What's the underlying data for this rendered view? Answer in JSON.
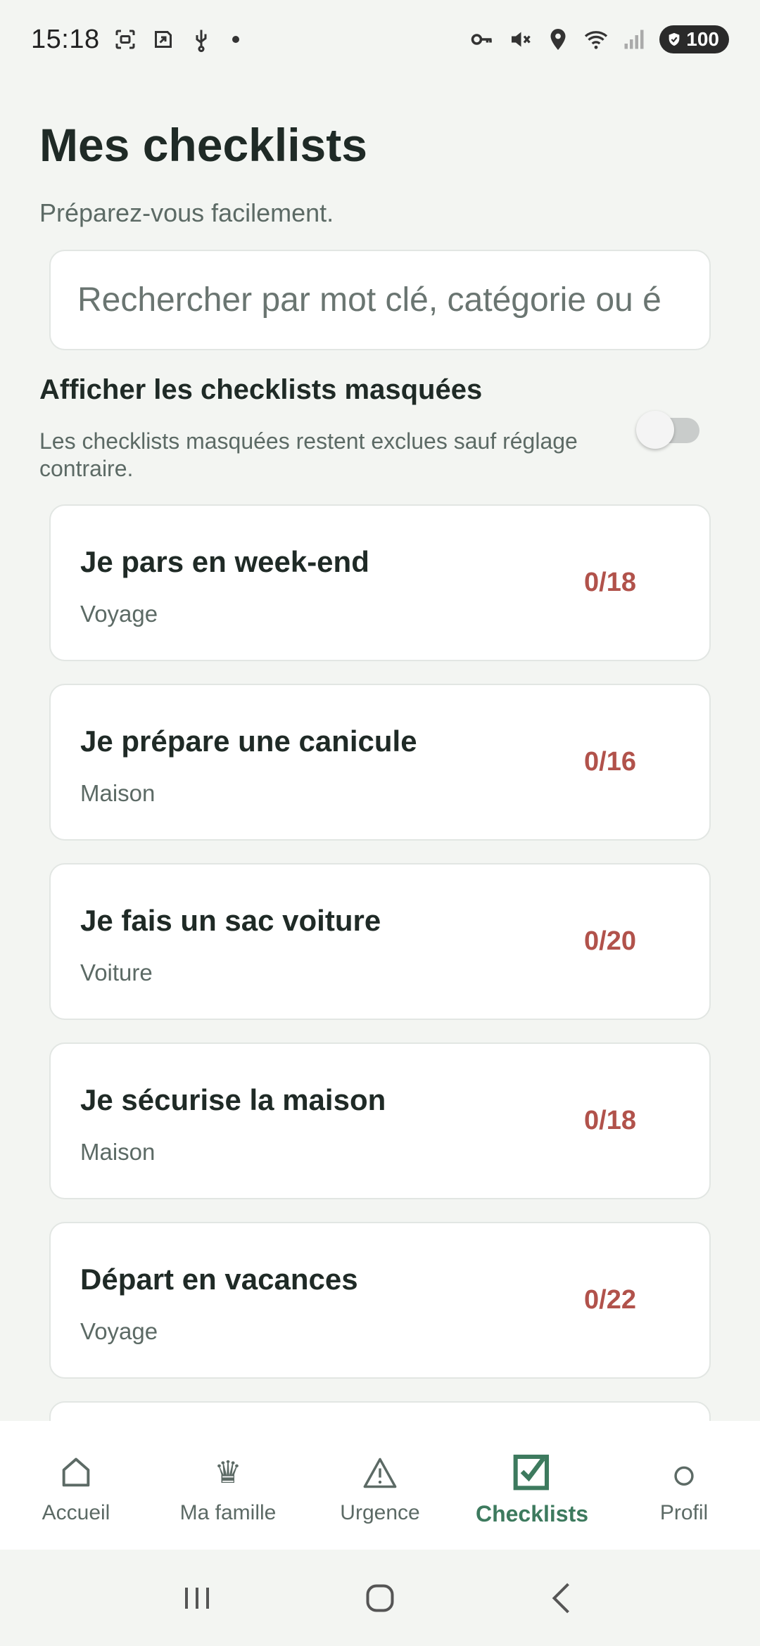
{
  "status_bar": {
    "time": "15:18",
    "battery": "100"
  },
  "header": {
    "title": "Mes checklists",
    "subtitle": "Préparez-vous facilement."
  },
  "search": {
    "placeholder": "Rechercher par mot clé, catégorie ou é",
    "value": ""
  },
  "hidden_toggle": {
    "title": "Afficher les checklists masquées",
    "description": "Les checklists masquées restent exclues sauf réglage contraire.",
    "enabled": false
  },
  "checklists": [
    {
      "title": "Je pars en week-end",
      "category": "Voyage",
      "progress": "0/18"
    },
    {
      "title": "Je prépare une canicule",
      "category": "Maison",
      "progress": "0/16"
    },
    {
      "title": "Je fais un sac voiture",
      "category": "Voiture",
      "progress": "0/20"
    },
    {
      "title": "Je sécurise la maison",
      "category": "Maison",
      "progress": "0/18"
    },
    {
      "title": "Départ en vacances",
      "category": "Voyage",
      "progress": "0/22"
    },
    {
      "title": "",
      "category": "",
      "progress": ""
    }
  ],
  "bottom_nav": {
    "items": [
      {
        "label": "Accueil",
        "icon": "home-icon",
        "active": false
      },
      {
        "label": "Ma famille",
        "icon": "crown-icon",
        "active": false
      },
      {
        "label": "Urgence",
        "icon": "warning-icon",
        "active": false
      },
      {
        "label": "Checklists",
        "icon": "checkbox-icon",
        "active": true
      },
      {
        "label": "Profil",
        "icon": "circle-icon",
        "active": false
      }
    ]
  },
  "colors": {
    "accent": "#3d7a5e",
    "progress": "#b1524b",
    "background": "#f3f5f2"
  }
}
